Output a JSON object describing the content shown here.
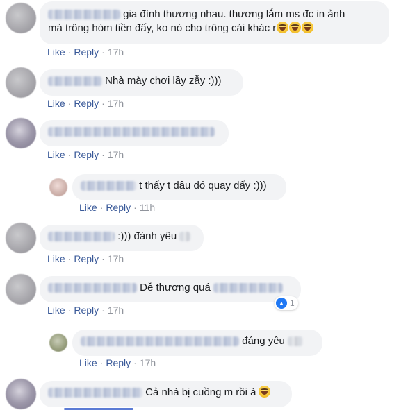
{
  "labels": {
    "like": "Like",
    "reply": "Reply"
  },
  "comments": [
    {
      "text_line1": "gia đình thương nhau. thương lắm ms đc in ảnh",
      "text_line2": "mà trông hòm tiền đấy, ko nó cho trông cái khác r",
      "time": "17h"
    },
    {
      "text": "Nhà mày chơi lầy zẫy :)))",
      "time": "17h"
    },
    {
      "text": "",
      "time": "17h"
    },
    {
      "text": "t thấy t đâu đó quay đấy :)))",
      "time": "11h",
      "reply": true
    },
    {
      "text": ":))) đánh yêu",
      "time": "17h"
    },
    {
      "text": "Dễ thương quá",
      "time": "17h",
      "reaction_count": "1"
    },
    {
      "text": "đáng yêu",
      "time": "17h",
      "reply": true
    },
    {
      "text": "Cả nhà bị cuồng m rồi à",
      "time": ""
    }
  ],
  "colors": {
    "link": "#385898",
    "bubble": "#f2f3f5",
    "like_blue": "#2078f4",
    "meta": "#90949c"
  },
  "icons": [
    "avatar-blurred",
    "laughing-emoji",
    "like-reaction-icon"
  ]
}
